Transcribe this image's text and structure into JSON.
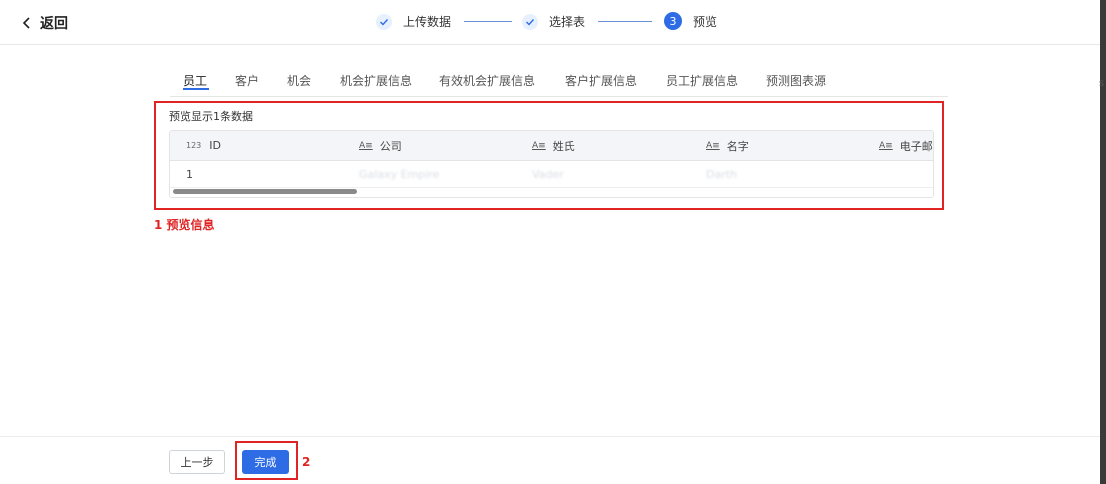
{
  "header": {
    "back_label": "返回",
    "steps": [
      {
        "label": "上传数据",
        "status": "done"
      },
      {
        "label": "选择表",
        "status": "done"
      },
      {
        "label": "预览",
        "status": "active",
        "number": "3"
      }
    ]
  },
  "tabs": [
    "员工",
    "客户",
    "机会",
    "机会扩展信息",
    "有效机会扩展信息",
    "客户扩展信息",
    "员工扩展信息",
    "预测图表源"
  ],
  "active_tab": "员工",
  "preview": {
    "summary": "预览显示1条数据",
    "columns": [
      {
        "type_icon": "123",
        "name": "ID"
      },
      {
        "type_icon": "A≡",
        "name": "公司"
      },
      {
        "type_icon": "A≡",
        "name": "姓氏"
      },
      {
        "type_icon": "A≡",
        "name": "名字"
      },
      {
        "type_icon": "A≡",
        "name": "电子邮"
      }
    ],
    "rows": [
      [
        "1",
        "Galaxy Empire",
        "Vader",
        "Darth",
        ""
      ]
    ]
  },
  "annotations": {
    "preview_label": "1 预览信息",
    "done_label": "2"
  },
  "footer": {
    "prev_label": "上一步",
    "done_label": "完成"
  },
  "edge_text": "s",
  "colors": {
    "accent": "#2e6ce6",
    "annotation": "#e02424"
  }
}
